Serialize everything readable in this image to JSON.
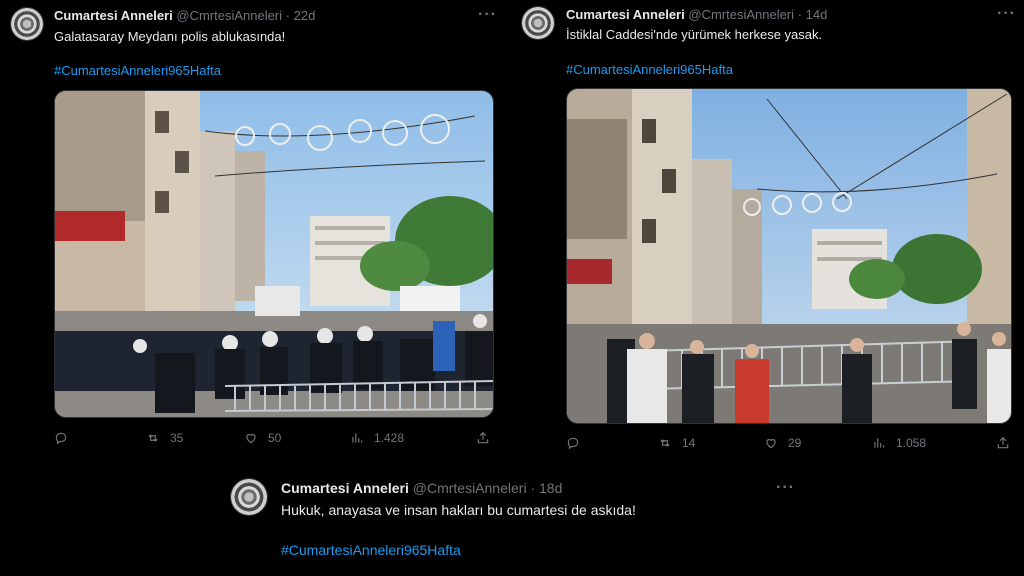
{
  "tweets": [
    {
      "name": "Cumartesi Anneleri",
      "handle": "@CmrtesiAnneleri",
      "dot": "·",
      "age": "22d",
      "more": "···",
      "text": "Galatasaray Meydanı polis ablukasında!",
      "hashtag": "#CumartesiAnneleri965Hafta",
      "photo_alt": "Police officers in helmets behind metal barricades on a tree-lined street",
      "stats": {
        "retweets": "35",
        "likes": "50",
        "views": "1.428"
      }
    },
    {
      "name": "Cumartesi Anneleri",
      "handle": "@CmrtesiAnneleri",
      "dot": "·",
      "age": "14d",
      "more": "···",
      "text": "İstiklal Caddesi'nde yürümek herkese yasak.",
      "hashtag": "#CumartesiAnneleri965Hafta",
      "photo_alt": "Pedestrians in front of metal barricades on İstiklal Avenue",
      "stats": {
        "retweets": "14",
        "likes": "29",
        "views": "1.058"
      }
    },
    {
      "name": "Cumartesi Anneleri",
      "handle": "@CmrtesiAnneleri",
      "dot": "·",
      "age": "18d",
      "more": "···",
      "text": "Hukuk, anayasa ve insan hakları bu cumartesi de askıda!",
      "hashtag": "#CumartesiAnneleri965Hafta"
    }
  ],
  "icons": {
    "reply": "reply-icon",
    "retweet": "retweet-icon",
    "like": "like-icon",
    "views": "views-icon",
    "share": "share-icon"
  },
  "colors": {
    "background": "#000000",
    "link": "#1d9bf0",
    "muted": "#71767b",
    "text": "#e7e9ea"
  }
}
